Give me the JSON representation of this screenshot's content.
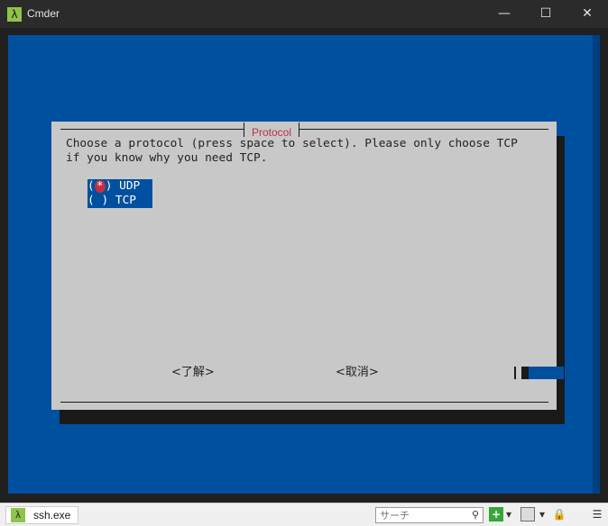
{
  "window": {
    "title": "Cmder",
    "app_icon": "λ",
    "minimize_glyph": "—",
    "maximize_glyph": "☐",
    "close_glyph": "✕"
  },
  "dialog": {
    "title": "Protocol",
    "prompt_line1": "Choose a protocol (press space to select). Please only choose TCP",
    "prompt_line2": "if you know why you need TCP.",
    "options": [
      {
        "mark": "*",
        "label": "UDP",
        "selected": true
      },
      {
        "mark": " ",
        "label": "TCP",
        "selected": false
      }
    ],
    "ok_label": "<了解>",
    "cancel_label": "<取消>"
  },
  "statusbar": {
    "tab_label": "ssh.exe",
    "tab_icon": "λ",
    "search_placeholder": "サーチ",
    "icons": [
      "search-icon",
      "add-console-icon",
      "dropdown-icon",
      "pane-icon",
      "dropdown-icon",
      "lock-icon",
      "menu-icon"
    ]
  },
  "colors": {
    "console_bg": "#0050a0",
    "dialog_bg": "#c8c8c8",
    "accent_red": "#c03040",
    "app_icon": "#8fc34a"
  }
}
